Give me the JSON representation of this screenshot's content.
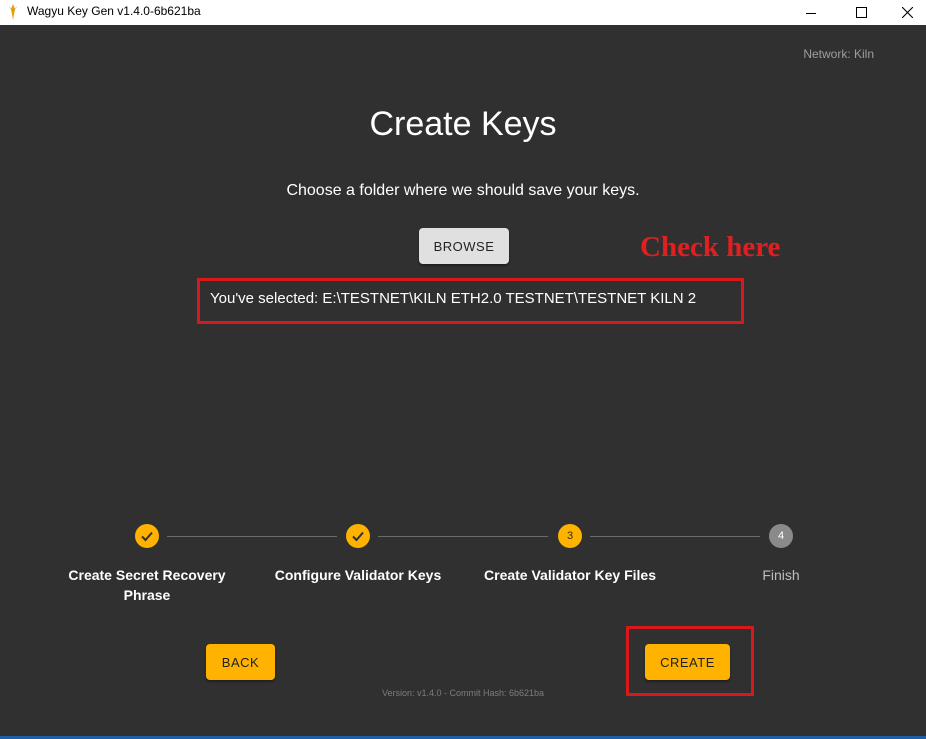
{
  "window": {
    "title": "Wagyu Key Gen v1.4.0-6b621ba",
    "app_icon": "wagyu-logo-icon",
    "controls": [
      "minimize-icon",
      "maximize-icon",
      "close-icon"
    ]
  },
  "header": {
    "network": "Network: Kiln"
  },
  "main": {
    "title": "Create Keys",
    "subtitle": "Choose a folder where we should save your keys.",
    "browse_label": "BROWSE",
    "selected_path": "You've selected: E:\\TESTNET\\KILN ETH2.0 TESTNET\\TESTNET KILN 2"
  },
  "annotation": {
    "text": "Check here",
    "color": "#d8191c"
  },
  "stepper": {
    "steps": [
      {
        "label": "Create Secret Recovery Phrase",
        "status": "completed",
        "icon": "check-icon"
      },
      {
        "label": "Configure Validator Keys",
        "status": "completed",
        "icon": "check-icon"
      },
      {
        "label": "Create Validator Key Files",
        "status": "active",
        "number": "3"
      },
      {
        "label": "Finish",
        "status": "pending",
        "number": "4"
      }
    ]
  },
  "footer": {
    "back_label": "BACK",
    "create_label": "CREATE",
    "version": "Version: v1.4.0 - Commit Hash: 6b621ba"
  },
  "colors": {
    "background": "#303030",
    "accent": "#ffb300",
    "titlebar": "#ffffff",
    "annotation": "#d8191c"
  }
}
